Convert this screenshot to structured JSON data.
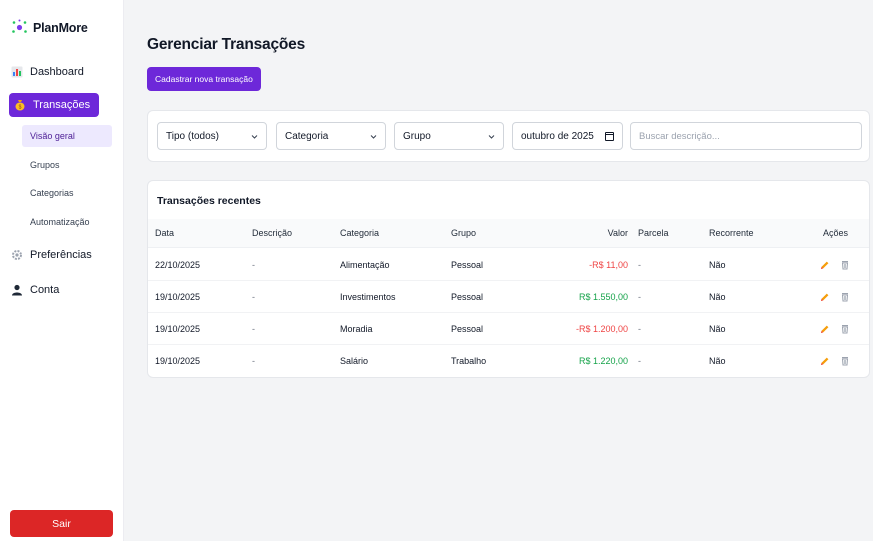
{
  "app": {
    "name": "PlanMore"
  },
  "sidebar": {
    "items": [
      {
        "label": "Dashboard",
        "icon": "bar-chart-icon"
      },
      {
        "label": "Transações",
        "icon": "money-bag-icon",
        "active": true
      },
      {
        "label": "Preferências",
        "icon": "gear-icon"
      },
      {
        "label": "Conta",
        "icon": "user-icon"
      }
    ],
    "subitems": [
      {
        "label": "Visão geral",
        "selected": true
      },
      {
        "label": "Grupos"
      },
      {
        "label": "Categorias"
      },
      {
        "label": "Automatização"
      }
    ],
    "logout_label": "Sair"
  },
  "page": {
    "title": "Gerenciar Transações",
    "new_button_label": "Cadastrar nova transação"
  },
  "filters": {
    "type_value": "Tipo (todos)",
    "category_value": "Categoria",
    "group_value": "Grupo",
    "month_value": "outubro de 2025",
    "search_placeholder": "Buscar descrição..."
  },
  "transactions": {
    "title": "Transações recentes",
    "headers": {
      "date": "Data",
      "description": "Descrição",
      "category": "Categoria",
      "group": "Grupo",
      "value": "Valor",
      "installment": "Parcela",
      "recurring": "Recorrente",
      "actions": "Ações"
    },
    "rows": [
      {
        "date": "22/10/2025",
        "description": "-",
        "category": "Alimentação",
        "group": "Pessoal",
        "value": "-R$ 11,00",
        "installment": "-",
        "recurring": "Não",
        "sign": "negative"
      },
      {
        "date": "19/10/2025",
        "description": "-",
        "category": "Investimentos",
        "group": "Pessoal",
        "value": "R$ 1.550,00",
        "installment": "-",
        "recurring": "Não",
        "sign": "positive"
      },
      {
        "date": "19/10/2025",
        "description": "-",
        "category": "Moradia",
        "group": "Pessoal",
        "value": "-R$ 1.200,00",
        "installment": "-",
        "recurring": "Não",
        "sign": "negative"
      },
      {
        "date": "19/10/2025",
        "description": "-",
        "category": "Salário",
        "group": "Trabalho",
        "value": "R$ 1.220,00",
        "installment": "-",
        "recurring": "Não",
        "sign": "positive"
      }
    ]
  },
  "colors": {
    "accent": "#6d28d9",
    "danger": "#dc2626",
    "negative": "#ef4444",
    "positive": "#16a34a"
  }
}
